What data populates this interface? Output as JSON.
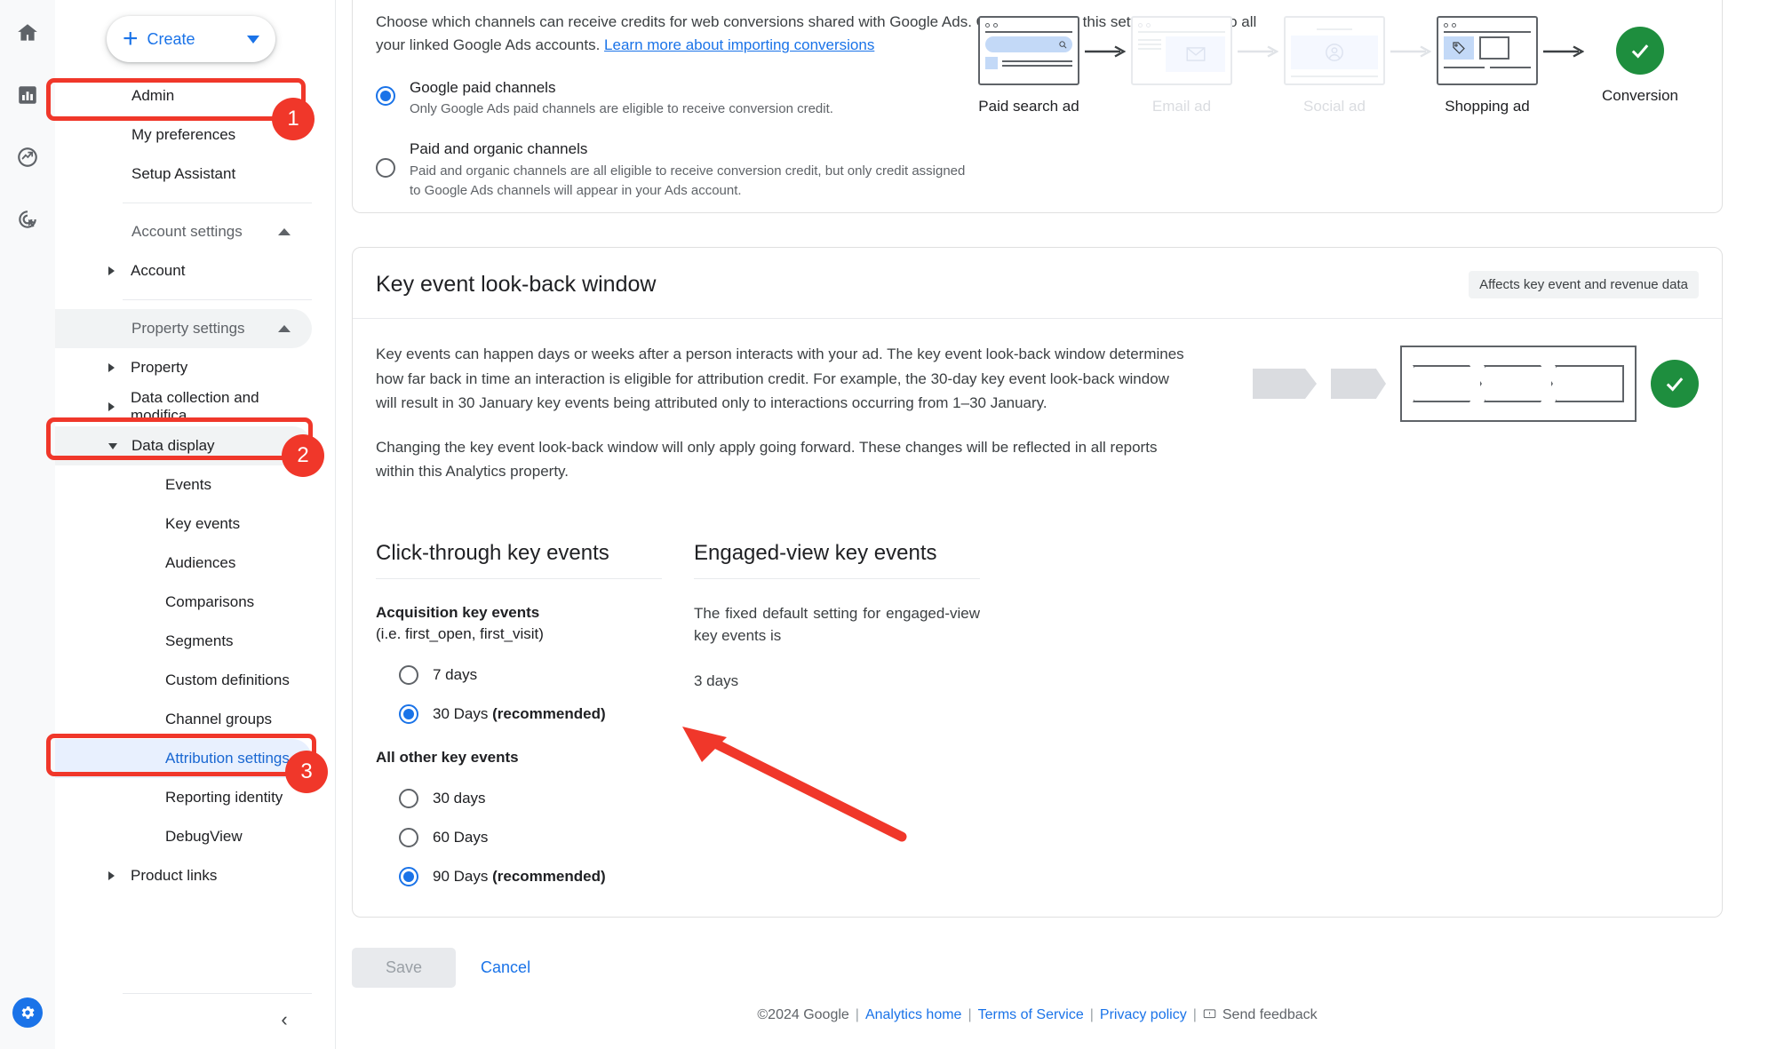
{
  "rail": {
    "icons": [
      {
        "name": "home-icon",
        "label": "Home"
      },
      {
        "name": "reports-bar-chart-icon",
        "label": "Reports"
      },
      {
        "name": "explore-trending-icon",
        "label": "Explore"
      },
      {
        "name": "advertising-target-icon",
        "label": "Advertising"
      }
    ],
    "settings_label": "Settings"
  },
  "sidebar": {
    "create_button": "Create",
    "items": [
      {
        "label": "Admin"
      },
      {
        "label": "My preferences"
      },
      {
        "label": "Setup Assistant"
      }
    ],
    "account_settings_label": "Account settings",
    "account_label": "Account",
    "property_settings_label": "Property settings",
    "property_label": "Property",
    "data_collection_label": "Data collection and modifica...",
    "data_display_label": "Data display",
    "data_display_children": [
      "Events",
      "Key events",
      "Audiences",
      "Comparisons",
      "Segments",
      "Custom definitions",
      "Channel groups",
      "Attribution settings",
      "Reporting identity",
      "DebugView"
    ],
    "selected_child": "Attribution settings",
    "product_links_label": "Product links",
    "collapse_label": "‹"
  },
  "annotations": [
    {
      "number": "1",
      "target": "Admin"
    },
    {
      "number": "2",
      "target": "Data display"
    },
    {
      "number": "3",
      "target": "Attribution settings"
    }
  ],
  "top_card": {
    "description_part1": "Choose which channels can receive credits for web conversions shared with Google Ads. Once changed, this setting will apply to all your linked Google Ads accounts. ",
    "link_text": "Learn more about importing conversions",
    "options": [
      {
        "title": "Google paid channels",
        "description": "Only Google Ads paid channels are eligible to receive conversion credit.",
        "selected": true
      },
      {
        "title": "Paid and organic channels",
        "description": "Paid and organic channels are all eligible to receive conversion credit, but only credit assigned to Google Ads channels will appear in your Ads account.",
        "selected": false
      }
    ],
    "illustration": [
      {
        "label": "Paid search ad",
        "state": "active",
        "icon": "search-ad-icon"
      },
      {
        "label": "Email ad",
        "state": "faded",
        "icon": "email-ad-icon"
      },
      {
        "label": "Social ad",
        "state": "faded",
        "icon": "social-ad-icon"
      },
      {
        "label": "Shopping ad",
        "state": "active",
        "icon": "shopping-ad-icon"
      },
      {
        "label": "Conversion",
        "state": "success",
        "icon": "check-circle-icon"
      }
    ]
  },
  "lookback_card": {
    "title": "Key event look-back window",
    "badge": "Affects key event and revenue data",
    "paragraph1": "Key events can happen days or weeks after a person interacts with your ad. The key event look-back window determines how far back in time an interaction is eligible for attribution credit. For example, the 30-day key event look-back window will result in 30 January key events being attributed only to interactions occurring from 1–30 January.",
    "paragraph2": "Changing the key event look-back window will only apply going forward. These changes will be reflected in all reports within this Analytics property.",
    "click_through": {
      "title": "Click-through key events",
      "group1_title_bold": "Acquisition key events",
      "group1_title_thin": "(i.e. first_open, first_visit)",
      "group1_options": [
        {
          "label": "7 days",
          "bold": "",
          "selected": false
        },
        {
          "label": "30 Days ",
          "bold": "(recommended)",
          "selected": true
        }
      ],
      "group2_title": "All other key events",
      "group2_options": [
        {
          "label": "30 days",
          "bold": "",
          "selected": false
        },
        {
          "label": "60 Days",
          "bold": "",
          "selected": false
        },
        {
          "label": "90 Days ",
          "bold": "(recommended)",
          "selected": true
        }
      ]
    },
    "engaged_view": {
      "title": "Engaged-view key events",
      "description": "The fixed default setting for engaged-view key events is",
      "value": "3 days"
    }
  },
  "actions": {
    "save_label": "Save",
    "cancel_label": "Cancel"
  },
  "footer": {
    "copyright": "©2024 Google",
    "sep": "|",
    "analytics_home": "Analytics home",
    "terms": "Terms of Service",
    "privacy": "Privacy policy",
    "send_feedback": "Send feedback"
  },
  "colors": {
    "accent_blue": "#1a73e8",
    "annotation_red": "#f0372a",
    "success_green": "#1e8e3e"
  }
}
